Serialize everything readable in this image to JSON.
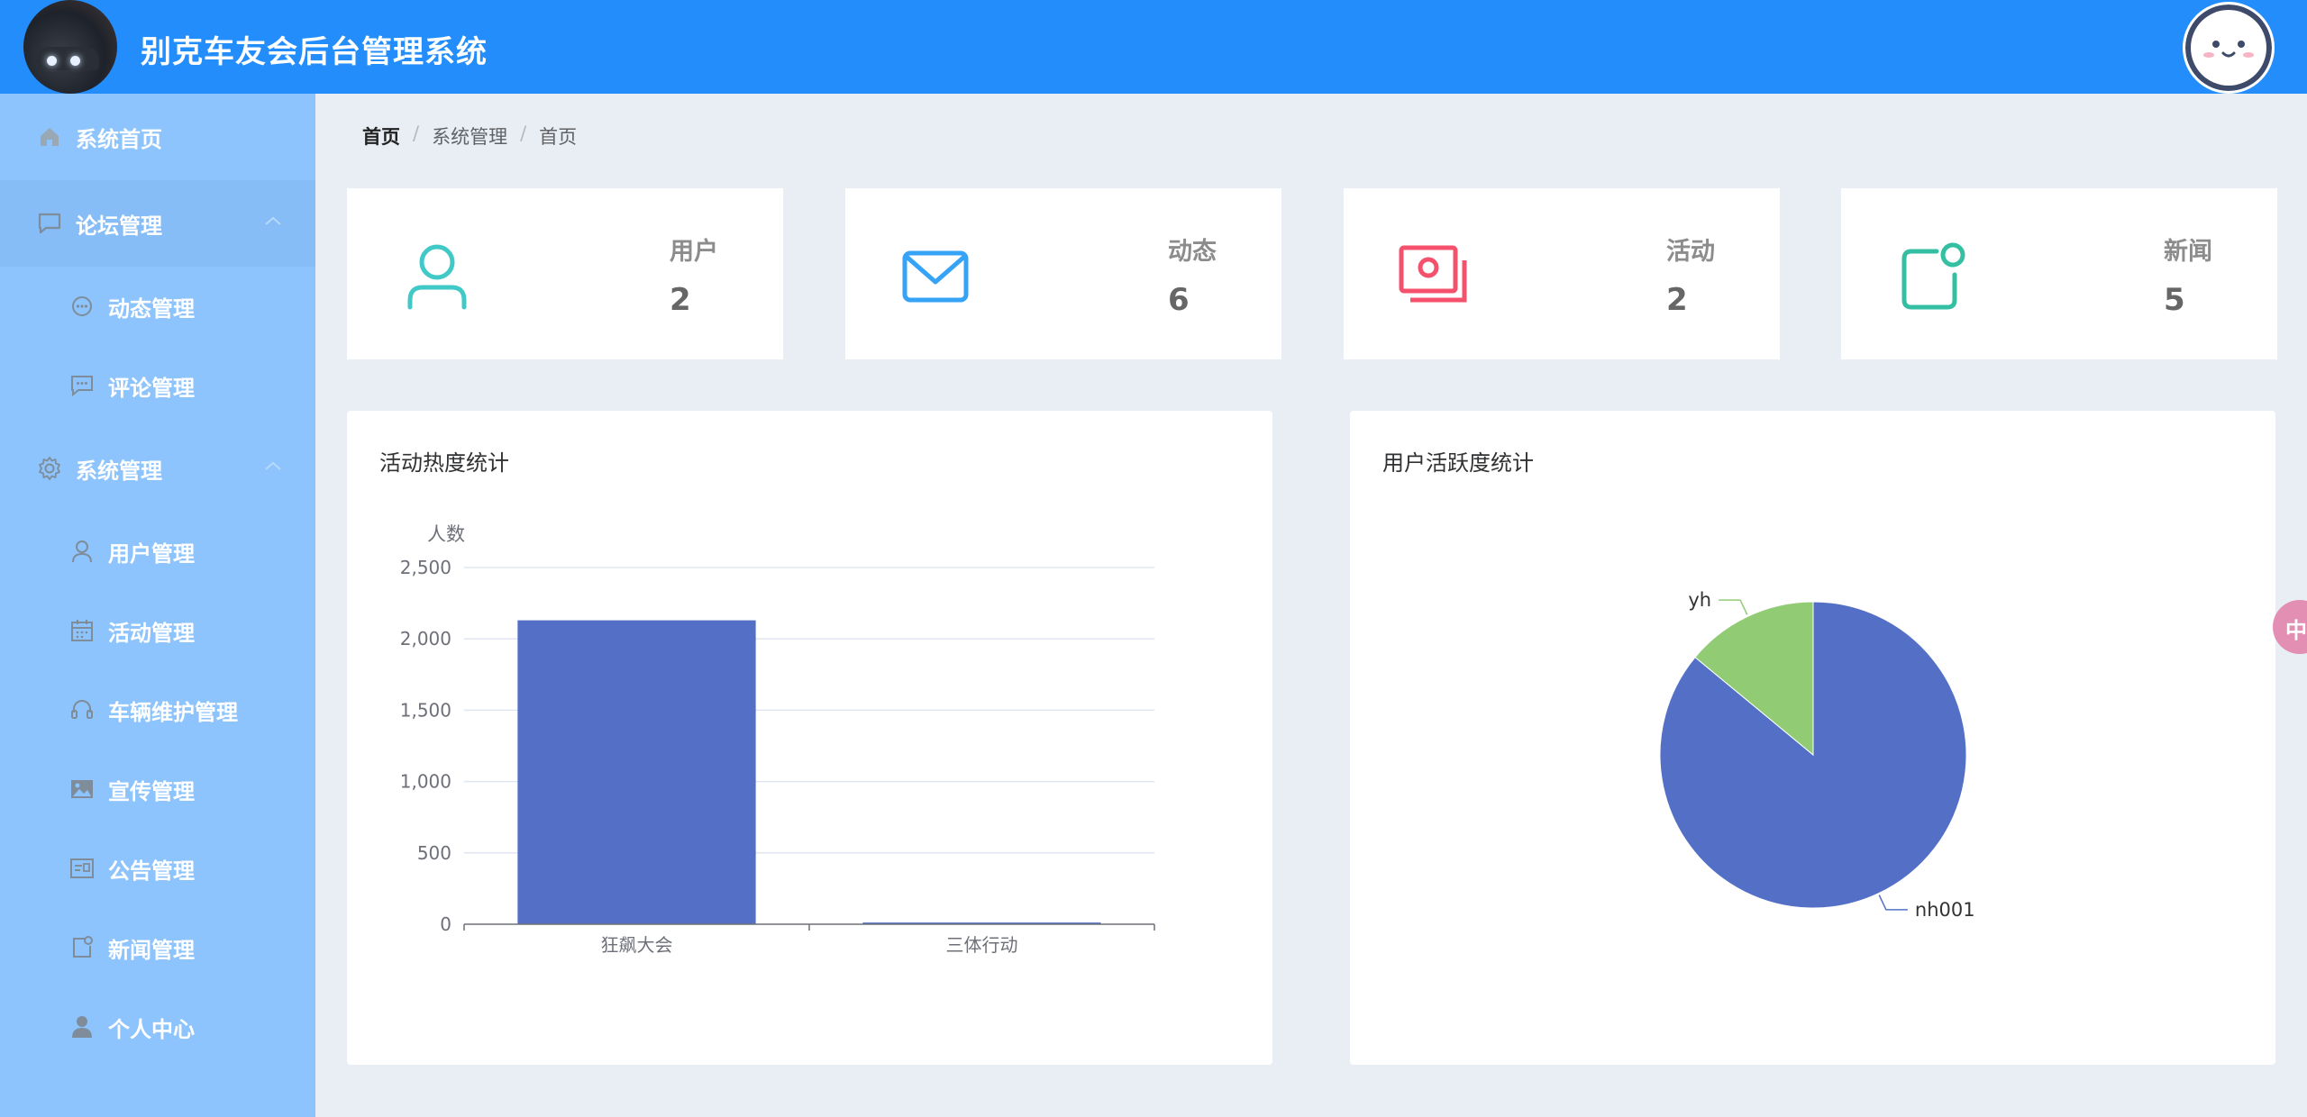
{
  "header": {
    "title": "别克车友会后台管理系统"
  },
  "sidebar": {
    "items": [
      {
        "label": "系统首页",
        "icon": "home-icon"
      },
      {
        "label": "论坛管理",
        "icon": "chat-bubble-icon"
      },
      {
        "label": "动态管理",
        "icon": "message-dots-icon"
      },
      {
        "label": "评论管理",
        "icon": "comment-icon"
      },
      {
        "label": "系统管理",
        "icon": "gear-icon"
      },
      {
        "label": "用户管理",
        "icon": "user-icon"
      },
      {
        "label": "活动管理",
        "icon": "calendar-icon"
      },
      {
        "label": "车辆维护管理",
        "icon": "headset-icon"
      },
      {
        "label": "宣传管理",
        "icon": "picture-icon"
      },
      {
        "label": "公告管理",
        "icon": "notice-card-icon"
      },
      {
        "label": "新闻管理",
        "icon": "news-icon"
      },
      {
        "label": "个人中心",
        "icon": "person-icon"
      }
    ]
  },
  "breadcrumb": {
    "items": [
      "首页",
      "系统管理",
      "首页"
    ],
    "separator": "/"
  },
  "stats": [
    {
      "label": "用户",
      "value": "2",
      "icon": "user-outline-icon",
      "color": "#40c9c6"
    },
    {
      "label": "动态",
      "value": "6",
      "icon": "envelope-icon",
      "color": "#36a3f7"
    },
    {
      "label": "活动",
      "value": "2",
      "icon": "money-card-icon",
      "color": "#f4516c"
    },
    {
      "label": "新闻",
      "value": "5",
      "icon": "notification-icon",
      "color": "#34bfa3"
    }
  ],
  "panels": {
    "activity_title": "活动热度统计",
    "user_title": "用户活跃度统计"
  },
  "side_tab": {
    "label": "中"
  },
  "colors": {
    "header": "#238dfb",
    "sidebar": "#8dc4fd",
    "bar": "#5470c6",
    "pie_secondary": "#91cc75"
  },
  "chart_data": [
    {
      "type": "bar",
      "title": "活动热度统计",
      "ylabel": "人数",
      "categories": [
        "狂飙大会",
        "三体行动"
      ],
      "values": [
        2130,
        12
      ],
      "ylim": [
        0,
        2500
      ],
      "yticks": [
        0,
        500,
        1000,
        1500,
        2000,
        2500
      ],
      "ytick_labels": [
        "0",
        "500",
        "1,000",
        "1,500",
        "2,000",
        "2,500"
      ],
      "grid": true
    },
    {
      "type": "pie",
      "title": "用户活跃度统计",
      "labels": [
        "nh001",
        "yh"
      ],
      "values": [
        86,
        14
      ],
      "colors": [
        "#5470c6",
        "#91cc75"
      ]
    }
  ]
}
